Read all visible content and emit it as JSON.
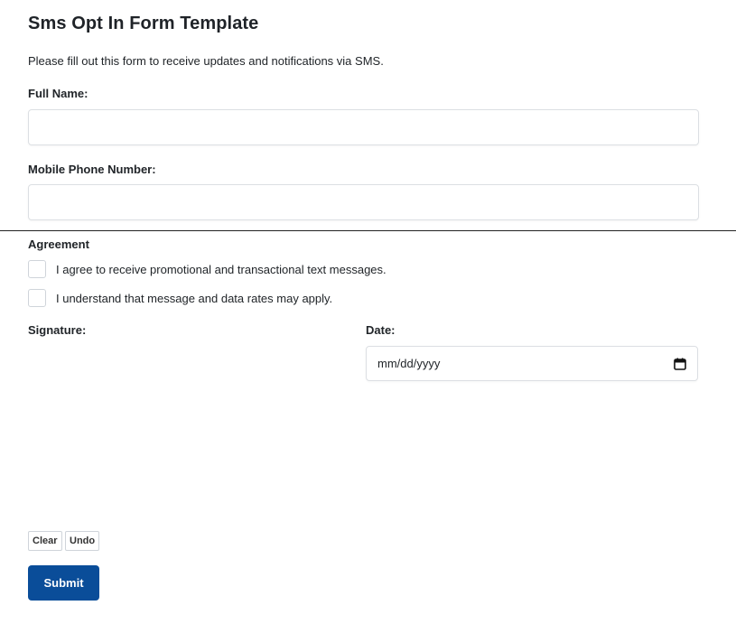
{
  "form": {
    "title": "Sms Opt In Form Template",
    "description": "Please fill out this form to receive updates and notifications via SMS.",
    "full_name": {
      "label": "Full Name:",
      "value": ""
    },
    "phone": {
      "label": "Mobile Phone Number:",
      "value": ""
    },
    "agreement": {
      "title": "Agreement",
      "items": [
        {
          "label": "I agree to receive promotional and transactional text messages.",
          "checked": false
        },
        {
          "label": "I understand that message and data rates may apply.",
          "checked": false
        }
      ]
    },
    "signature": {
      "label": "Signature:"
    },
    "date": {
      "label": "Date:",
      "placeholder": "mm/dd/yyyy",
      "icon": "calendar-icon"
    },
    "buttons": {
      "clear": "Clear",
      "undo": "Undo",
      "submit": "Submit"
    },
    "colors": {
      "submit_bg": "#0a4d99",
      "border": "#dcdfe3"
    }
  }
}
